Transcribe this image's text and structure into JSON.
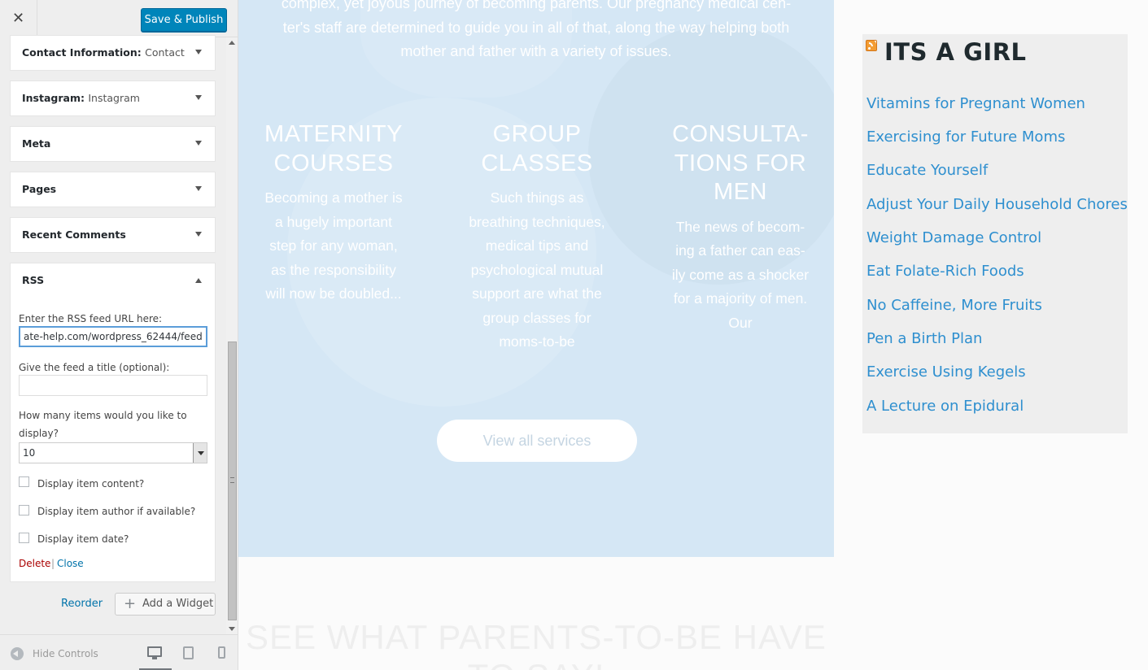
{
  "customizer": {
    "close_icon": "close-icon",
    "save_label": "Save & Publish",
    "widgets": [
      {
        "title": "Contact Information:",
        "subtitle": "Contact..."
      },
      {
        "title": "Instagram:",
        "subtitle": "Instagram"
      },
      {
        "title": "Meta",
        "subtitle": ""
      },
      {
        "title": "Pages",
        "subtitle": ""
      },
      {
        "title": "Recent Comments",
        "subtitle": ""
      },
      {
        "title": "RSS",
        "subtitle": ""
      }
    ],
    "rss_form": {
      "url_label": "Enter the RSS feed URL here:",
      "url_value": "ate-help.com/wordpress_62444/feed",
      "title_label": "Give the feed a title (optional):",
      "title_value": "",
      "count_label_1": "How many items would you like to",
      "count_label_2": "display?",
      "count_value": "10",
      "checkboxes": [
        {
          "label": "Display item content?",
          "checked": false
        },
        {
          "label": "Display item author if available?",
          "checked": false
        },
        {
          "label": "Display item date?",
          "checked": false
        }
      ],
      "delete_label": "Delete",
      "separator": "|",
      "close_label": "Close"
    },
    "reorder_label": "Reorder",
    "add_widget_label": "Add a Widget",
    "add_widget_icon": "+",
    "hide_controls_label": "Hide Controls"
  },
  "preview": {
    "intro_lines": [
      "complex, yet joyous journey of becoming parents. Our pregnancy medical cen-",
      "ter's staff are determined to guide you in all of that, along the way helping both",
      "mother and father with a variety of issues."
    ],
    "services": [
      {
        "title_lines": [
          "MATERNITY",
          "COURSES"
        ],
        "text_lines": [
          "Becoming a mother is",
          "a hugely important",
          "step for any woman,",
          "as the responsibility",
          "will now be doubled..."
        ]
      },
      {
        "title_lines": [
          "GROUP",
          "CLASSES"
        ],
        "text_lines": [
          "Such things as",
          "breathing techniques,",
          "medical tips and",
          "psychological mutual",
          "support are what the",
          "group classes for",
          "moms-to-be"
        ]
      },
      {
        "title_lines": [
          "CONSULTA-",
          "TIONS FOR",
          "MEN"
        ],
        "text_lines": [
          "The news of becom-",
          "ing a father can eas-",
          "ily come as a shocker",
          "for a majority of men.",
          "Our"
        ]
      }
    ],
    "view_all_label": "View all services",
    "testimonials_title_lines": [
      "SEE WHAT PARENTS-TO-BE HAVE",
      "TO SAY!"
    ]
  },
  "rss_widget": {
    "icon": "rss-icon",
    "title": "ITS A GIRL",
    "link_color": "#2e8fcf",
    "links": [
      "Vitamins for Pregnant Women",
      "Exercising for Future Moms",
      "Educate Yourself",
      "Adjust Your Daily Household Chores",
      "Weight Damage Control",
      "Eat Folate-Rich Foods",
      "No Caffeine, More Fruits",
      "Pen a Birth Plan",
      "Exercise Using Kegels",
      "A Lecture on Epidural"
    ]
  },
  "colors": {
    "primary_button": "#0085ba",
    "link": "#0073aa",
    "delete": "#aa0000",
    "services_bg": "#d5e7f5"
  }
}
